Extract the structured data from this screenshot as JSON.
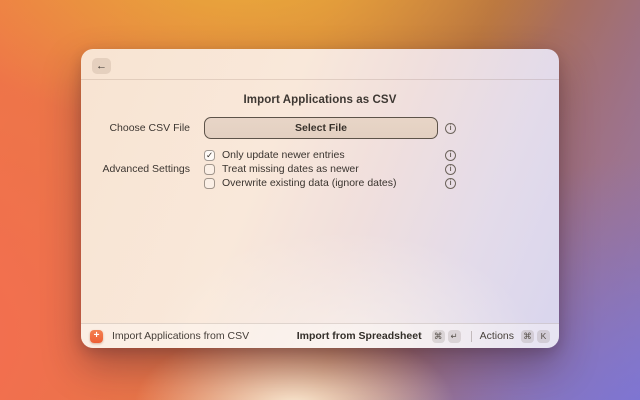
{
  "window": {
    "title": "Import Applications as CSV",
    "header": {
      "back_icon": "←"
    },
    "form": {
      "file_field": {
        "label": "Choose CSV File",
        "button_label": "Select File",
        "info_icon": "i"
      },
      "advanced": {
        "label": "Advanced Settings",
        "options": [
          {
            "label": "Only update newer entries",
            "checked": true,
            "check": "✓",
            "info_icon": "i"
          },
          {
            "label": "Treat missing dates as newer",
            "checked": false,
            "check": "",
            "info_icon": "i"
          },
          {
            "label": "Overwrite existing data (ignore dates)",
            "checked": false,
            "check": "",
            "info_icon": "i"
          }
        ]
      }
    },
    "footer": {
      "app_icon": "+",
      "app_label": "Import Applications from CSV",
      "primary_action": {
        "label": "Import from Spreadsheet",
        "keys": [
          "⌘",
          "↵"
        ]
      },
      "actions": {
        "label": "Actions",
        "keys": [
          "⌘",
          "K"
        ]
      }
    }
  },
  "colors": {
    "accent_orange": "#ee6a3c",
    "text_dark": "#3b3530",
    "button_fill": "#e6d3c4",
    "button_border": "#5d5349",
    "background_orange": "#ec7a43",
    "background_purple": "#8b82cc",
    "background_gold": "#ecb03a"
  }
}
